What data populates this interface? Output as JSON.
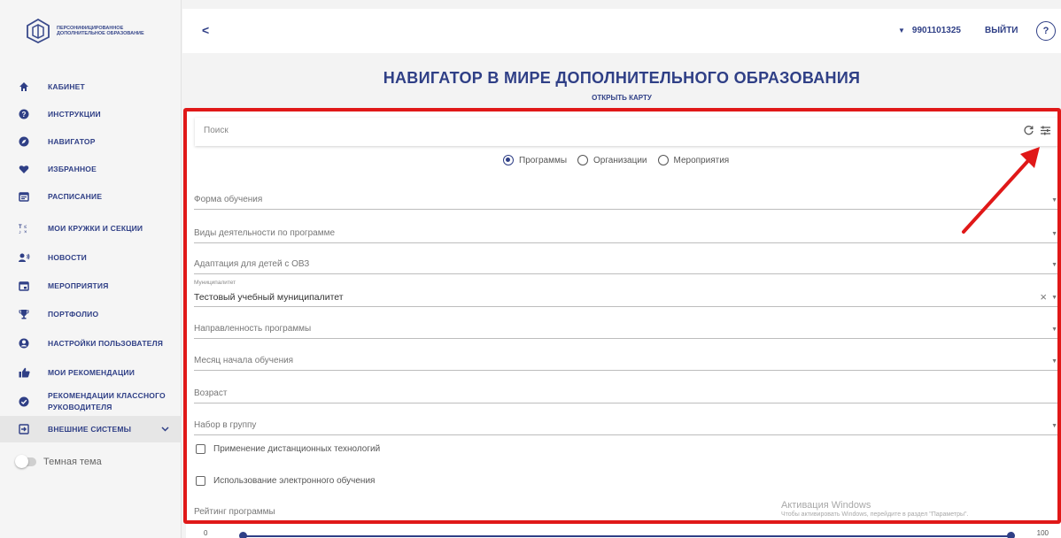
{
  "brand": {
    "logo_text": "Персонифицированное дополнительное образование"
  },
  "sidebar": {
    "items": [
      {
        "label": "КАБИНЕТ",
        "icon": "home-icon"
      },
      {
        "label": "ИНСТРУКЦИИ",
        "icon": "help-circle-icon"
      },
      {
        "label": "НАВИГАТОР",
        "icon": "compass-icon"
      },
      {
        "label": "ИЗБРАННОЕ",
        "icon": "heart-icon"
      },
      {
        "label": "РАСПИСАНИЕ",
        "icon": "calendar-icon"
      },
      {
        "label": "МОИ КРУЖКИ И СЕКЦИИ",
        "icon": "sports-icon"
      },
      {
        "label": "НОВОСТИ",
        "icon": "news-icon"
      },
      {
        "label": "МЕРОПРИЯТИЯ",
        "icon": "event-icon"
      },
      {
        "label": "ПОРТФОЛИО",
        "icon": "trophy-icon"
      },
      {
        "label": "НАСТРОЙКИ ПОЛЬЗОВАТЕЛЯ",
        "icon": "user-settings-icon"
      },
      {
        "label": "МОИ РЕКОМЕНДАЦИИ",
        "icon": "thumbs-up-icon"
      },
      {
        "label": "РЕКОМЕНДАЦИИ КЛАССНОГО РУКОВОДИТЕЛЯ",
        "icon": "check-circle-icon"
      },
      {
        "label": "ВНЕШНИЕ СИСТЕМЫ",
        "icon": "login-icon"
      }
    ],
    "dark_theme_label": "Темная тема",
    "dark_theme_on": false
  },
  "topbar": {
    "back": "<",
    "phone": "9901101325",
    "logout": "ВЫЙТИ",
    "help": "?"
  },
  "page": {
    "title": "НАВИГАТОР В МИРЕ ДОПОЛНИТЕЛЬНОГО ОБРАЗОВАНИЯ",
    "map_link": "ОТКРЫТЬ КАРТУ"
  },
  "search": {
    "placeholder": "Поиск",
    "value": ""
  },
  "filter_type": {
    "options": [
      "Программы",
      "Организации",
      "Мероприятия"
    ],
    "selected": "Программы"
  },
  "filters": {
    "form": "Форма обучения",
    "activities": "Виды деятельности по программе",
    "adaptation": "Адаптация для детей с ОВЗ",
    "municipality_caption": "Муниципалитет",
    "municipality_value": "Тестовый учебный муниципалитет",
    "direction": "Направленность программы",
    "start_month": "Месяц начала обучения",
    "age": "Возраст",
    "enrollment": "Набор в группу",
    "distance": "Применение дистанционных технологий",
    "elearning": "Использование электронного обучения",
    "rating": "Рейтинг программы"
  },
  "rating_slider": {
    "min": "0",
    "max": "100",
    "low": 0,
    "high": 100
  },
  "watermark": {
    "line1": "Активация Windows",
    "line2": "Чтобы активировать Windows, перейдите в раздел \"Параметры\"."
  },
  "colors": {
    "accent": "#2f3f86",
    "highlight": "#e01818"
  }
}
